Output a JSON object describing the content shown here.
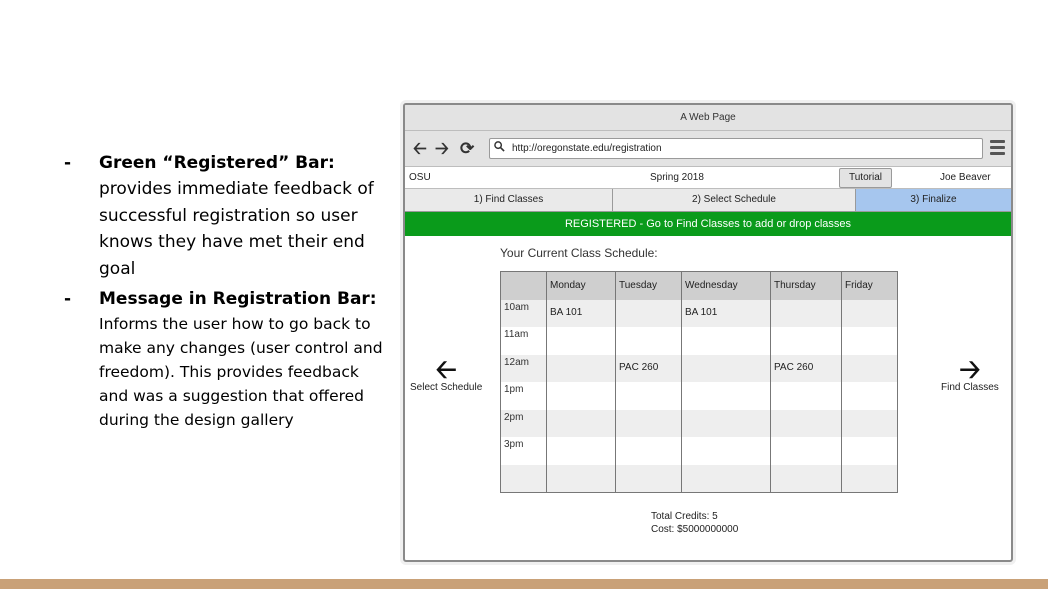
{
  "notes": [
    {
      "head": "Green “Registered” Bar:",
      "text": "provides immediate feedback of successful registration so user knows they have met their end goal"
    },
    {
      "head": "Message in Registration Bar:",
      "text": "Informs the user how to go back to make any changes (user control and freedom). This provides feedback and was a suggestion that offered during the design gallery"
    }
  ],
  "bullet": "-",
  "browser": {
    "title": "A Web Page",
    "url": "http://oregonstate.edu/registration",
    "icons": {
      "back": "back-arrow-icon",
      "forward": "forward-arrow-icon",
      "reload": "reload-icon",
      "search": "search-icon",
      "menu": "hamburger-menu-icon"
    }
  },
  "info": {
    "org": "OSU",
    "term": "Spring 2018",
    "tutorial": "Tutorial",
    "user": "Joe Beaver"
  },
  "steps": [
    "1) Find Classes",
    "2) Select Schedule",
    "3) Finalize"
  ],
  "active_step_color": "#a6c6ee",
  "registered_bar": {
    "text": "REGISTERED - Go to Find Classes to add or drop classes",
    "color": "#0a9b1b"
  },
  "schedule": {
    "title": "Your Current Class Schedule:",
    "days": [
      "Monday",
      "Tuesday",
      "Wednesday",
      "Thursday",
      "Friday"
    ],
    "rows": [
      {
        "time": "10am",
        "cells": [
          "BA 101",
          "",
          "BA 101",
          "",
          ""
        ]
      },
      {
        "time": "11am",
        "cells": [
          "",
          "",
          "",
          "",
          ""
        ]
      },
      {
        "time": "12am",
        "cells": [
          "",
          "PAC 260",
          "",
          "PAC 260",
          ""
        ]
      },
      {
        "time": "1pm",
        "cells": [
          "",
          "",
          "",
          "",
          ""
        ]
      },
      {
        "time": "2pm",
        "cells": [
          "",
          "",
          "",
          "",
          ""
        ]
      },
      {
        "time": "3pm",
        "cells": [
          "",
          "",
          "",
          "",
          ""
        ]
      },
      {
        "time": "",
        "cells": [
          "",
          "",
          "",
          "",
          ""
        ]
      }
    ]
  },
  "nav_left": {
    "label": "Select Schedule",
    "icon": "arrow-left-icon"
  },
  "nav_right": {
    "label": "Find Classes",
    "icon": "arrow-right-icon"
  },
  "totals": {
    "credits": "Total Credits: 5",
    "cost": "Cost: $5000000000"
  }
}
